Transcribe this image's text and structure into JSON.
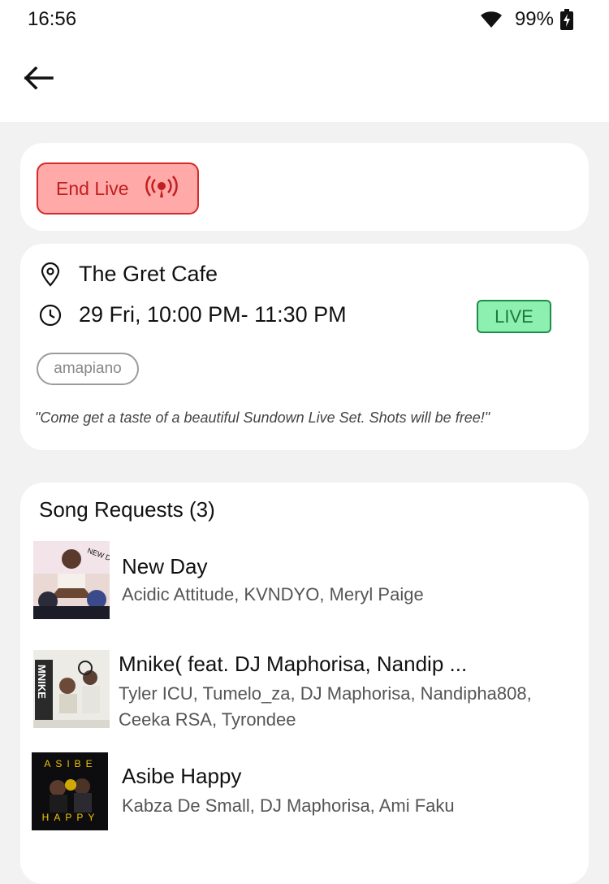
{
  "status_bar": {
    "time": "16:56",
    "battery": "99%"
  },
  "live_card": {
    "end_live_label": "End Live"
  },
  "event": {
    "venue": "The Gret Cafe",
    "time": "29 Fri, 10:00 PM- 11:30 PM",
    "live_badge": "LIVE",
    "genre": "amapiano",
    "description": "\"Come get a taste of a beautiful Sundown Live Set. Shots will be free!\""
  },
  "requests": {
    "title": "Song Requests (3)",
    "songs": [
      {
        "title": "New Day",
        "artists": "Acidic Attitude, KVNDYO, Meryl Paige"
      },
      {
        "title": "Mnike( feat. DJ Maphorisa, Nandip ...",
        "artists_line1": "Tyler ICU, Tumelo_za, DJ Maphorisa, Nandipha808,",
        "artists_line2": "Ceeka RSA, Tyrondee"
      },
      {
        "title": "Asibe Happy",
        "artists": "Kabza De Small, DJ Maphorisa, Ami Faku"
      }
    ]
  },
  "colors": {
    "end_live_bg": "#ffa9a9",
    "end_live_border": "#d42a2a",
    "live_badge_bg": "#8ef0b0",
    "live_badge_text": "#1a7a40"
  },
  "icons": [
    "wifi-icon",
    "battery-icon",
    "back-arrow-icon",
    "broadcast-icon",
    "location-pin-icon",
    "clock-icon"
  ],
  "album_art": {
    "song_1": "NEW DAY",
    "song_2": "MNIKE",
    "song_3_top": "ASIBE",
    "song_3_bottom": "HAPPY"
  }
}
